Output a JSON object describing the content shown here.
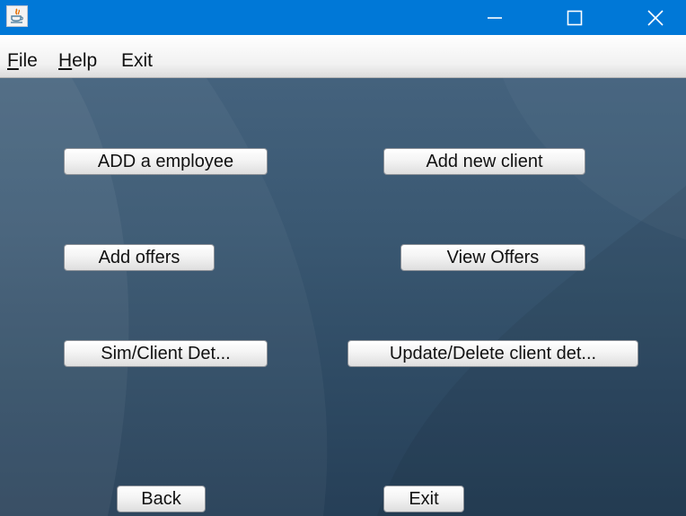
{
  "window": {
    "icon": "java-cup-icon",
    "controls": {
      "minimize": "minimize-icon",
      "maximize": "maximize-icon",
      "close": "close-icon"
    }
  },
  "menu": {
    "file": {
      "mnemonic": "F",
      "rest": "ile"
    },
    "help": {
      "mnemonic": "H",
      "rest": "elp"
    },
    "exit": {
      "label": "Exit"
    }
  },
  "buttons": {
    "add_employee": "ADD a employee",
    "add_new_client": "Add new client",
    "add_offers": "Add offers",
    "view_offers": "View Offers",
    "sim_client_details": "Sim/Client Det...",
    "update_delete_client": "Update/Delete client det...",
    "back": "Back",
    "exit": "Exit"
  },
  "colors": {
    "titlebar": "#0078d7",
    "background_dark": "#263f57",
    "background_light": "#44627d"
  }
}
